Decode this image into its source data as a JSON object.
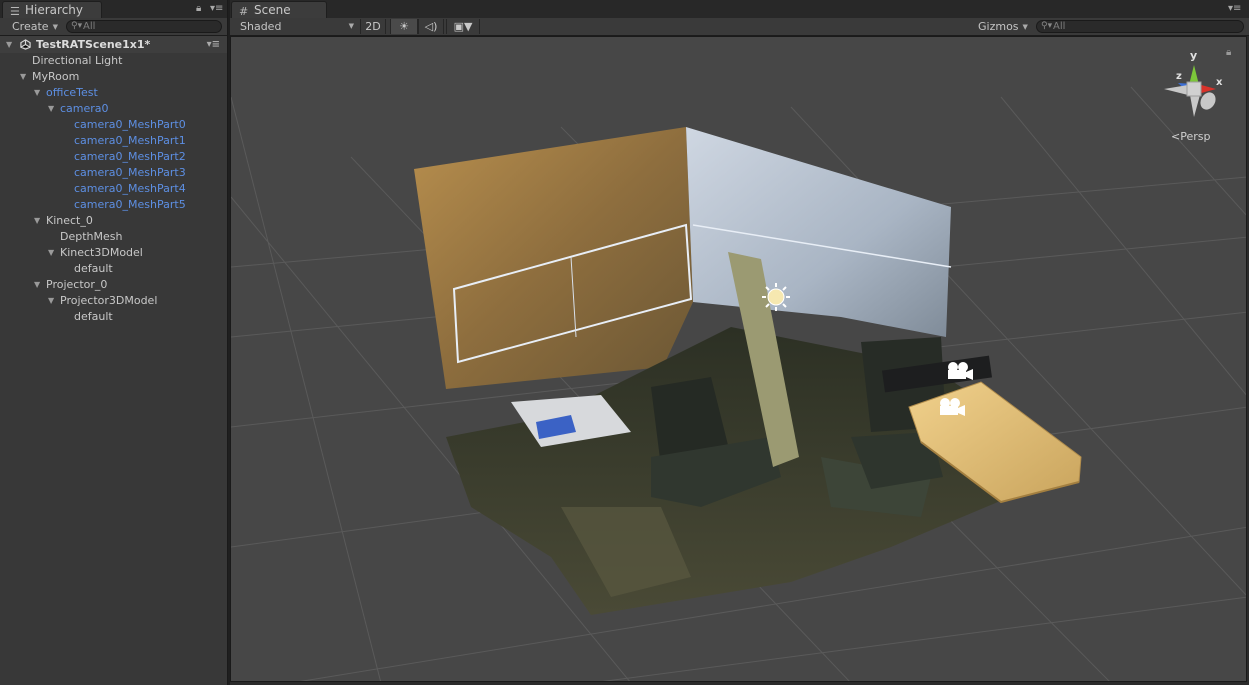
{
  "hierarchy": {
    "tab_label": "Hierarchy",
    "create_label": "Create",
    "search_placeholder": "All",
    "scene_name": "TestRATScene1x1*",
    "items": [
      {
        "label": "Directional Light",
        "indent": 1,
        "expanded": null,
        "selected": false
      },
      {
        "label": "MyRoom",
        "indent": 1,
        "expanded": true,
        "selected": false
      },
      {
        "label": "officeTest",
        "indent": 2,
        "expanded": true,
        "selected": true
      },
      {
        "label": "camera0",
        "indent": 3,
        "expanded": true,
        "selected": true
      },
      {
        "label": "camera0_MeshPart0",
        "indent": 4,
        "expanded": null,
        "selected": true
      },
      {
        "label": "camera0_MeshPart1",
        "indent": 4,
        "expanded": null,
        "selected": true
      },
      {
        "label": "camera0_MeshPart2",
        "indent": 4,
        "expanded": null,
        "selected": true
      },
      {
        "label": "camera0_MeshPart3",
        "indent": 4,
        "expanded": null,
        "selected": true
      },
      {
        "label": "camera0_MeshPart4",
        "indent": 4,
        "expanded": null,
        "selected": true
      },
      {
        "label": "camera0_MeshPart5",
        "indent": 4,
        "expanded": null,
        "selected": true
      },
      {
        "label": "Kinect_0",
        "indent": 2,
        "expanded": true,
        "selected": false
      },
      {
        "label": "DepthMesh",
        "indent": 3,
        "expanded": null,
        "selected": false
      },
      {
        "label": "Kinect3DModel",
        "indent": 3,
        "expanded": true,
        "selected": false
      },
      {
        "label": "default",
        "indent": 4,
        "expanded": null,
        "selected": false
      },
      {
        "label": "Projector_0",
        "indent": 2,
        "expanded": true,
        "selected": false
      },
      {
        "label": "Projector3DModel",
        "indent": 3,
        "expanded": true,
        "selected": false
      },
      {
        "label": "default",
        "indent": 4,
        "expanded": null,
        "selected": false
      }
    ]
  },
  "scene": {
    "tab_label": "Scene",
    "shading_mode": "Shaded",
    "mode_2d_label": "2D",
    "gizmos_label": "Gizmos",
    "search_placeholder": "All",
    "projection_label": "Persp",
    "axis_labels": {
      "x": "x",
      "y": "y",
      "z": "z"
    }
  },
  "colors": {
    "selected_text": "#5d8fe3",
    "panel_bg": "#383838",
    "viewport_bg": "#474747",
    "gizmo_x": "#d8322a",
    "gizmo_y": "#7cc63a",
    "gizmo_z": "#3c6fd6",
    "projector_box": "#e9c77e"
  },
  "icons": {
    "hierarchy_tab": "list-icon",
    "scene_tab": "grid-icon",
    "lighting_toggle": "sun-icon",
    "audio_toggle": "speaker-icon",
    "effects_toggle": "image-icon",
    "lock": "lock-icon",
    "menu": "menu-icon",
    "search": "search-icon",
    "light_gizmo": "sun-icon",
    "camera_gizmo": "movie-camera-icon"
  }
}
